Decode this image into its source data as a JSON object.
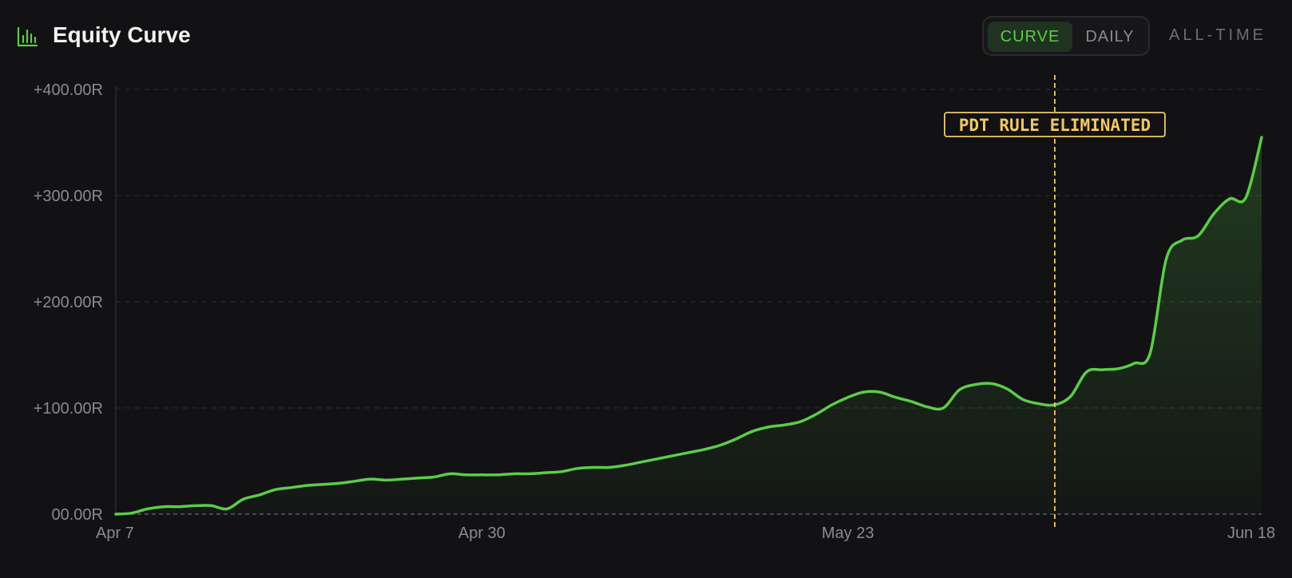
{
  "header": {
    "title": "Equity Curve",
    "icon": "bar-chart-icon"
  },
  "toggle": {
    "curve_label": "CURVE",
    "daily_label": "DAILY",
    "selected": "CURVE"
  },
  "range_label": "ALL-TIME",
  "colors": {
    "background": "#121214",
    "line": "#5ccc4a",
    "annotation": "#f0c868",
    "grid": "#2a2a2d",
    "tick": "#8a8a8f"
  },
  "chart_data": {
    "type": "area",
    "title": "",
    "xlabel": "",
    "ylabel": "",
    "ylim": [
      0,
      400
    ],
    "y_ticks": [
      0,
      100,
      200,
      300,
      400
    ],
    "y_tick_labels": [
      "00.00R",
      "+100.00R",
      "+200.00R",
      "+300.00R",
      "+400.00R"
    ],
    "x_ticks": [
      "2025-04-07",
      "2025-04-30",
      "2025-05-23",
      "2025-06-18"
    ],
    "x_tick_labels": [
      "Apr 7",
      "Apr 30",
      "May 23",
      "Jun 18"
    ],
    "grid": true,
    "annotation": {
      "date": "2025-06-05",
      "label": "PDT RULE ELIMINATED"
    },
    "series": [
      {
        "points": [
          [
            "2025-04-07",
            0
          ],
          [
            "2025-04-08",
            1
          ],
          [
            "2025-04-09",
            5
          ],
          [
            "2025-04-10",
            7
          ],
          [
            "2025-04-11",
            7
          ],
          [
            "2025-04-12",
            8
          ],
          [
            "2025-04-13",
            8
          ],
          [
            "2025-04-14",
            5
          ],
          [
            "2025-04-15",
            14
          ],
          [
            "2025-04-16",
            18
          ],
          [
            "2025-04-17",
            23
          ],
          [
            "2025-04-18",
            25
          ],
          [
            "2025-04-19",
            27
          ],
          [
            "2025-04-20",
            28
          ],
          [
            "2025-04-21",
            29
          ],
          [
            "2025-04-22",
            31
          ],
          [
            "2025-04-23",
            33
          ],
          [
            "2025-04-24",
            32
          ],
          [
            "2025-04-25",
            33
          ],
          [
            "2025-04-26",
            34
          ],
          [
            "2025-04-27",
            35
          ],
          [
            "2025-04-28",
            38
          ],
          [
            "2025-04-29",
            37
          ],
          [
            "2025-04-30",
            37
          ],
          [
            "2025-05-01",
            37
          ],
          [
            "2025-05-02",
            38
          ],
          [
            "2025-05-03",
            38
          ],
          [
            "2025-05-04",
            39
          ],
          [
            "2025-05-05",
            40
          ],
          [
            "2025-05-06",
            43
          ],
          [
            "2025-05-07",
            44
          ],
          [
            "2025-05-08",
            44
          ],
          [
            "2025-05-09",
            46
          ],
          [
            "2025-05-10",
            49
          ],
          [
            "2025-05-11",
            52
          ],
          [
            "2025-05-12",
            55
          ],
          [
            "2025-05-13",
            58
          ],
          [
            "2025-05-14",
            61
          ],
          [
            "2025-05-15",
            65
          ],
          [
            "2025-05-16",
            71
          ],
          [
            "2025-05-17",
            78
          ],
          [
            "2025-05-18",
            82
          ],
          [
            "2025-05-19",
            84
          ],
          [
            "2025-05-20",
            87
          ],
          [
            "2025-05-21",
            94
          ],
          [
            "2025-05-22",
            103
          ],
          [
            "2025-05-23",
            110
          ],
          [
            "2025-05-24",
            115
          ],
          [
            "2025-05-25",
            115
          ],
          [
            "2025-05-26",
            110
          ],
          [
            "2025-05-27",
            106
          ],
          [
            "2025-05-28",
            101
          ],
          [
            "2025-05-29",
            100
          ],
          [
            "2025-05-30",
            117
          ],
          [
            "2025-05-31",
            122
          ],
          [
            "2025-06-01",
            123
          ],
          [
            "2025-06-02",
            118
          ],
          [
            "2025-06-03",
            108
          ],
          [
            "2025-06-04",
            104
          ],
          [
            "2025-06-05",
            103
          ],
          [
            "2025-06-06",
            111
          ],
          [
            "2025-06-07",
            134
          ],
          [
            "2025-06-08",
            136
          ],
          [
            "2025-06-09",
            137
          ],
          [
            "2025-06-10",
            142
          ],
          [
            "2025-06-11",
            152
          ],
          [
            "2025-06-12",
            240
          ],
          [
            "2025-06-13",
            258
          ],
          [
            "2025-06-14",
            262
          ],
          [
            "2025-06-15",
            283
          ],
          [
            "2025-06-16",
            297
          ],
          [
            "2025-06-17",
            298
          ],
          [
            "2025-06-18",
            355
          ]
        ]
      }
    ]
  }
}
